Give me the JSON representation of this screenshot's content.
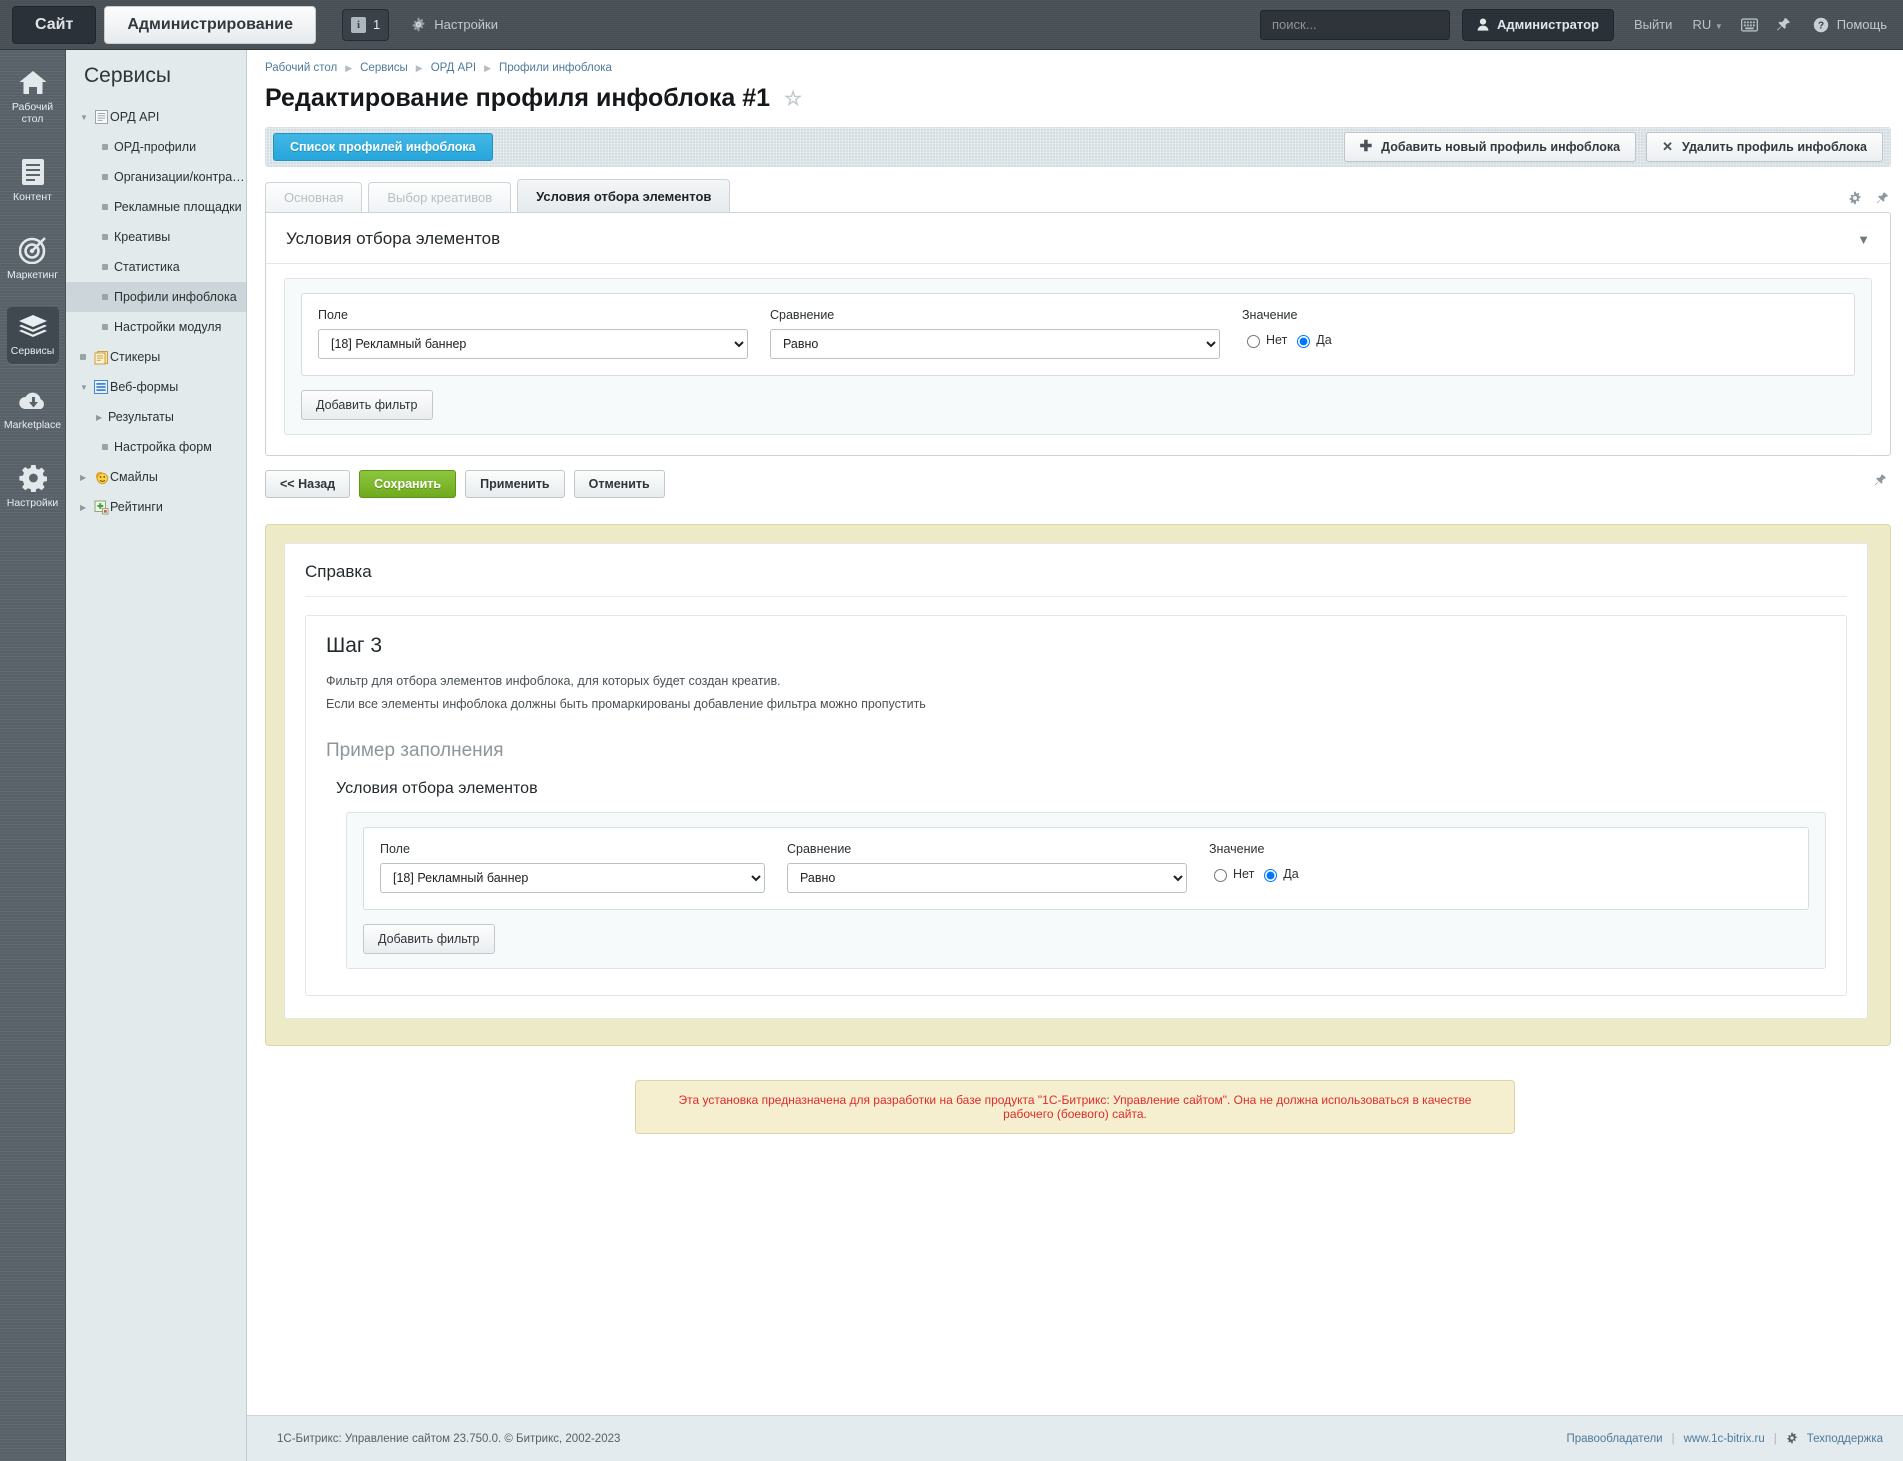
{
  "topbar": {
    "site_tab": "Сайт",
    "admin_tab": "Администрирование",
    "counter": "1",
    "counter_icon": "info-icon",
    "settings_label": "Настройки",
    "settings_icon": "gear-icon",
    "search_placeholder": "поиск...",
    "search_value": "",
    "search_icon": "search-icon",
    "user_label": "Администратор",
    "user_icon": "user-icon",
    "logout_label": "Выйти",
    "lang_label": "RU",
    "keyboard_icon": "keyboard-icon",
    "pin_icon": "pin-icon",
    "help_label": "Помощь",
    "help_icon": "question-circle-icon"
  },
  "iconbar": {
    "items": [
      {
        "label": "Рабочий стол",
        "icon": "home-icon",
        "active": false
      },
      {
        "label": "Контент",
        "icon": "document-icon",
        "active": false
      },
      {
        "label": "Маркетинг",
        "icon": "target-icon",
        "active": false
      },
      {
        "label": "Сервисы",
        "icon": "layers-icon",
        "active": true
      },
      {
        "label": "Marketplace",
        "icon": "cloud-download-icon",
        "active": false
      },
      {
        "label": "Настройки",
        "icon": "gear-icon",
        "active": false
      }
    ]
  },
  "sidebar": {
    "title": "Сервисы",
    "items": [
      {
        "label": "ОРД API",
        "level": 1,
        "arrow": "down",
        "icon": "page-icon",
        "selected": false
      },
      {
        "label": "ОРД-профили",
        "level": 2,
        "arrow": "",
        "icon": "dot",
        "selected": false
      },
      {
        "label": "Организации/контрагенты",
        "level": 2,
        "arrow": "",
        "icon": "dot",
        "selected": false
      },
      {
        "label": "Рекламные площадки",
        "level": 2,
        "arrow": "",
        "icon": "dot",
        "selected": false
      },
      {
        "label": "Креативы",
        "level": 2,
        "arrow": "",
        "icon": "dot",
        "selected": false
      },
      {
        "label": "Статистика",
        "level": 2,
        "arrow": "",
        "icon": "dot",
        "selected": false
      },
      {
        "label": "Профили инфоблока",
        "level": 2,
        "arrow": "",
        "icon": "dot",
        "selected": true
      },
      {
        "label": "Настройки модуля",
        "level": 2,
        "arrow": "",
        "icon": "dot",
        "selected": false
      },
      {
        "label": "Стикеры",
        "level": 1,
        "arrow": "dot",
        "icon": "sticker-icon",
        "selected": false
      },
      {
        "label": "Веб-формы",
        "level": 1,
        "arrow": "down",
        "icon": "webform-icon",
        "selected": false
      },
      {
        "label": "Результаты",
        "level": 2,
        "arrow": "right",
        "icon": "",
        "selected": false
      },
      {
        "label": "Настройка форм",
        "level": 2,
        "arrow": "",
        "icon": "dot",
        "selected": false
      },
      {
        "label": "Смайлы",
        "level": 1,
        "arrow": "right",
        "icon": "smiley-icon",
        "selected": false
      },
      {
        "label": "Рейтинги",
        "level": 1,
        "arrow": "right",
        "icon": "rating-icon",
        "selected": false
      }
    ]
  },
  "breadcrumb": [
    "Рабочий стол",
    "Сервисы",
    "ОРД API",
    "Профили инфоблока"
  ],
  "page": {
    "title": "Редактирование профиля инфоблока #1",
    "favorite_icon": "star-outline-icon"
  },
  "toolbar": {
    "primary_label": "Список профилей инфоблока",
    "add_label": "Добавить новый профиль инфоблока",
    "add_icon": "plus-icon",
    "delete_label": "Удалить профиль инфоблока",
    "delete_icon": "cross-icon"
  },
  "tabs": [
    {
      "label": "Основная",
      "active": false
    },
    {
      "label": "Выбор креативов",
      "active": false
    },
    {
      "label": "Условия отбора элементов",
      "active": true
    }
  ],
  "tab_icons": {
    "settings_icon": "gear-icon",
    "pin_icon": "pin-icon"
  },
  "panel": {
    "heading": "Условия отбора элементов",
    "collapse_icon": "chevron-down-icon"
  },
  "filter": {
    "field_label": "Поле",
    "field_value": "[18] Рекламный баннер",
    "compare_label": "Сравнение",
    "compare_value": "Равно",
    "value_label": "Значение",
    "radio_no": "Нет",
    "radio_yes": "Да",
    "radio_selected": "Да",
    "add_filter_label": "Добавить фильтр"
  },
  "actions": {
    "back": "<< Назад",
    "save": "Сохранить",
    "apply": "Применить",
    "cancel": "Отменить",
    "pin_icon": "pin-icon"
  },
  "help": {
    "title": "Справка",
    "step_title": "Шаг 3",
    "paragraph_1": "Фильтр для отбора элементов инфоблока, для которых будет создан креатив.",
    "paragraph_2": "Если все элементы инфоблока должны быть промаркированы добавление фильтра можно пропустить",
    "example_title": "Пример заполнения",
    "example_subtitle": "Условия отбора элементов"
  },
  "notice": {
    "text": "Эта установка предназначена для разработки на базе продукта \"1С-Битрикс: Управление сайтом\". Она не должна использоваться в качестве рабочего (боевого) сайта."
  },
  "footer": {
    "copyright": "1С-Битрикс: Управление сайтом 23.750.0. © Битрикс, 2002-2023",
    "rightholders": "Правообладатели",
    "site_url": "www.1c-bitrix.ru",
    "support": "Техподдержка",
    "support_icon": "gear-icon"
  },
  "colors": {
    "accent_blue": "#26a6dc",
    "save_green": "#7cb327",
    "notice_red": "#e02b2b"
  }
}
